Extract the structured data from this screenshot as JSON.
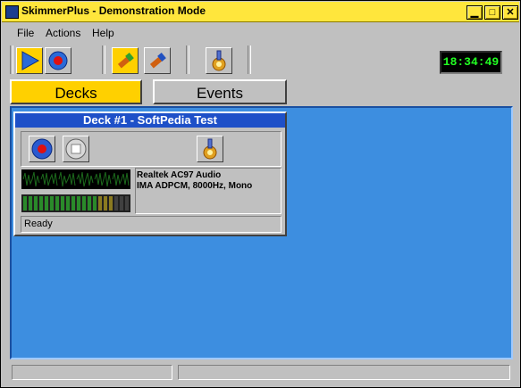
{
  "window": {
    "title": "SkimmerPlus - Demonstration Mode",
    "controls": {
      "minimize": "▁",
      "maximize": "□",
      "close": "✕"
    }
  },
  "menu": [
    {
      "label": "File"
    },
    {
      "label": "Actions"
    },
    {
      "label": "Help"
    }
  ],
  "toolbar": {
    "buttons": [
      "play-icon",
      "record-icon",
      "edit-tool-icon",
      "gear-settings-icon"
    ],
    "clock": "18:34:49"
  },
  "tabs": [
    {
      "label": "Decks",
      "active": true
    },
    {
      "label": "Events",
      "active": false
    }
  ],
  "deck": {
    "title": "Deck #1 - SoftPedia Test",
    "device_line1": "Realtek AC97 Audio",
    "device_line2": "IMA ADPCM, 8000Hz, Mono",
    "status": "Ready",
    "level_fraction": 0.83
  },
  "colors": {
    "titlebar": "#ffe63c",
    "active_tab": "#ffd000",
    "main_bg": "#3d8ee0",
    "deck_title_bg": "#1e50c8",
    "clock_text": "#22ff22"
  }
}
